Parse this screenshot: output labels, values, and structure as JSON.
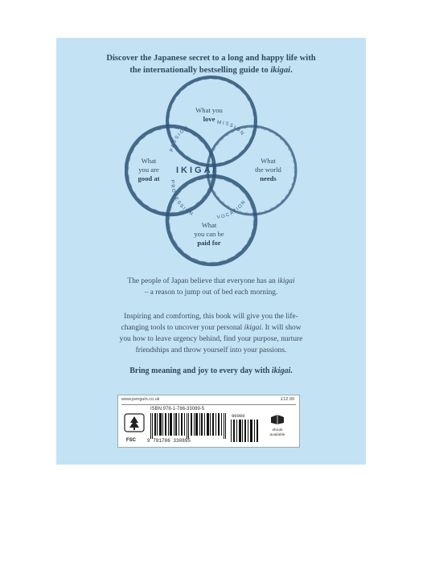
{
  "headline": {
    "line1": "Discover the Japanese secret to a long and happy life with",
    "line2_prefix": "the internationally bestselling guide to ",
    "line2_em": "ikigai",
    "line2_suffix": "."
  },
  "diagram": {
    "center": "IKIGAI",
    "love": {
      "line1": "What you",
      "bold": "love"
    },
    "good_at": {
      "line1": "What",
      "line2": "you are",
      "bold": "good at"
    },
    "world_needs": {
      "line1": "What",
      "line2": "the world",
      "bold": "needs"
    },
    "paid_for": {
      "line1": "What",
      "line2": "you can be",
      "bold": "paid for"
    },
    "arcs": {
      "passion": "PASSION",
      "mission": "MISSION",
      "profession": "PROFESSION",
      "vocation": "VOCATION"
    }
  },
  "para1": {
    "line1_prefix": "The people of Japan believe that everyone has an ",
    "line1_em": "ikigai",
    "line2": "– a reason to jump out of bed each morning."
  },
  "para2": {
    "line1": "Inspiring and comforting, this book will give you the life-",
    "line2_prefix": "changing tools to uncover your personal ",
    "line2_em": "ikigai",
    "line2_suffix": ". It will show",
    "line3": "you how to leave urgency behind, find your purpose, nurture",
    "line4": "friendships and throw yourself into your passions."
  },
  "final": {
    "prefix": "Bring meaning and joy to every day with ",
    "em": "ikigai",
    "suffix": "."
  },
  "barcode": {
    "website": "www.penguin.co.uk",
    "price": "£12.99",
    "isbn": "ISBN  978-1-786-33089-5",
    "fsc": "FSC",
    "digits": "9 781786 330895",
    "addon": "90000",
    "ebook_line1": "ebook",
    "ebook_line2": "available"
  },
  "colors": {
    "background": "#c3e3f5",
    "ring": "#2f5476",
    "text": "#3b4b59"
  }
}
